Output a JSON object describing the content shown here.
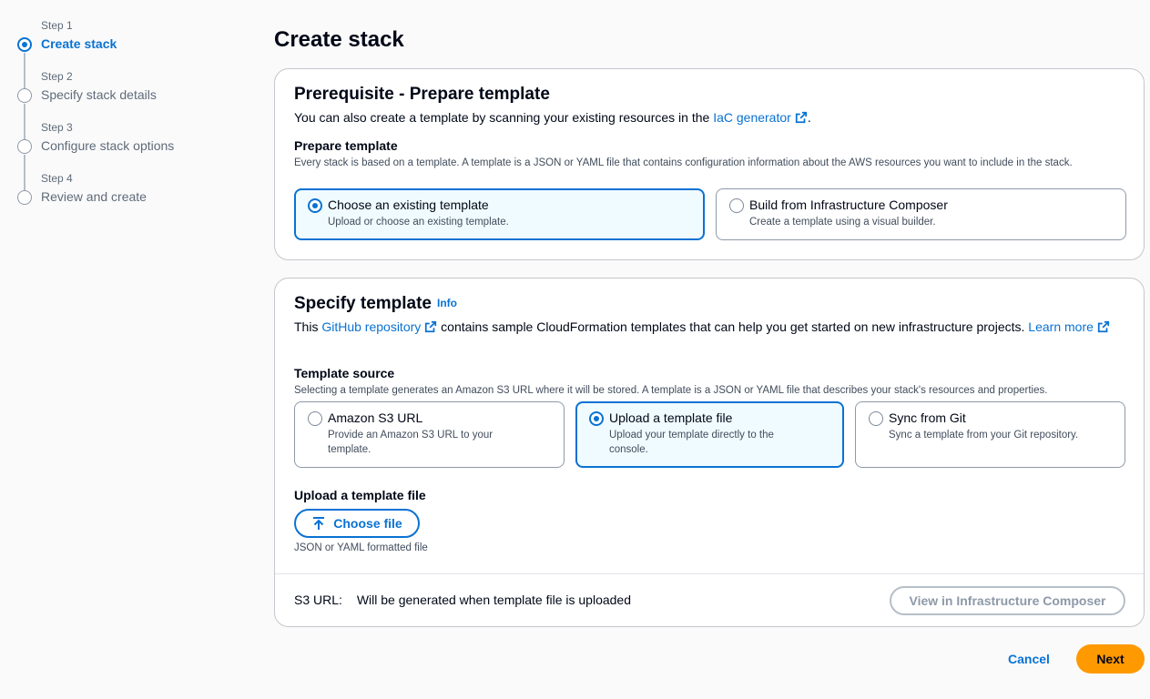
{
  "stepper": {
    "steps": [
      {
        "num": "Step 1",
        "name": "Create stack",
        "active": true
      },
      {
        "num": "Step 2",
        "name": "Specify stack details",
        "active": false
      },
      {
        "num": "Step 3",
        "name": "Configure stack options",
        "active": false
      },
      {
        "num": "Step 4",
        "name": "Review and create",
        "active": false
      }
    ]
  },
  "page": {
    "title": "Create stack"
  },
  "prerequisite": {
    "title": "Prerequisite - Prepare template",
    "desc_before": "You can also create a template by scanning your existing resources in the ",
    "desc_link": "IaC generator",
    "desc_after": ".",
    "field_label": "Prepare template",
    "field_hint": "Every stack is based on a template. A template is a JSON or YAML file that contains configuration information about the AWS resources you want to include in the stack.",
    "options": [
      {
        "title": "Choose an existing template",
        "desc": "Upload or choose an existing template.",
        "selected": true
      },
      {
        "title": "Build from Infrastructure Composer",
        "desc": "Create a template using a visual builder.",
        "selected": false
      }
    ]
  },
  "specify": {
    "title": "Specify template",
    "info": "Info",
    "desc_this": "This ",
    "desc_link1": "GitHub repository",
    "desc_mid": " contains sample CloudFormation templates that can help you get started on new infrastructure projects. ",
    "desc_link2": "Learn more",
    "source_label": "Template source",
    "source_hint": "Selecting a template generates an Amazon S3 URL where it will be stored. A template is a JSON or YAML file that describes your stack's resources and properties.",
    "options": [
      {
        "title": "Amazon S3 URL",
        "desc": "Provide an Amazon S3 URL to your template.",
        "selected": false
      },
      {
        "title": "Upload a template file",
        "desc": "Upload your template directly to the console.",
        "selected": true
      },
      {
        "title": "Sync from Git",
        "desc": "Sync a template from your Git repository.",
        "selected": false
      }
    ],
    "upload_label": "Upload a template file",
    "choose_file": "Choose file",
    "upload_hint": "JSON or YAML formatted file",
    "s3_label": "S3 URL:",
    "s3_value": "Will be generated when template file is uploaded",
    "view_composer": "View in Infrastructure Composer"
  },
  "footer": {
    "cancel": "Cancel",
    "next": "Next"
  },
  "colors": {
    "accent": "#0972d3",
    "primary_button": "#ff9900"
  }
}
